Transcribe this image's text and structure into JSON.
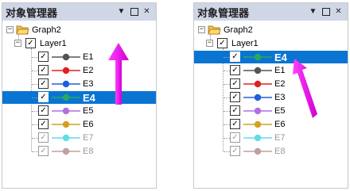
{
  "panels": [
    {
      "title": "对象管理器",
      "graph": "Graph2",
      "layer": "Layer1",
      "items": [
        {
          "label": "E1",
          "color": "#555555",
          "dim": false,
          "selected": false
        },
        {
          "label": "E2",
          "color": "#e02020",
          "dim": false,
          "selected": false
        },
        {
          "label": "E3",
          "color": "#1e60d8",
          "dim": false,
          "selected": false
        },
        {
          "label": "E4",
          "color": "#2aa860",
          "dim": false,
          "selected": true
        },
        {
          "label": "E5",
          "color": "#b070e0",
          "dim": false,
          "selected": false
        },
        {
          "label": "E6",
          "color": "#d4a020",
          "dim": false,
          "selected": false
        },
        {
          "label": "E7",
          "color": "#60dcea",
          "dim": true,
          "selected": false
        },
        {
          "label": "E8",
          "color": "#c0a0a0",
          "dim": true,
          "selected": false
        }
      ]
    },
    {
      "title": "对象管理器",
      "graph": "Graph2",
      "layer": "Layer1",
      "items": [
        {
          "label": "E4",
          "color": "#2aa860",
          "dim": false,
          "selected": true
        },
        {
          "label": "E1",
          "color": "#555555",
          "dim": false,
          "selected": false
        },
        {
          "label": "E2",
          "color": "#e02020",
          "dim": false,
          "selected": false
        },
        {
          "label": "E3",
          "color": "#1e60d8",
          "dim": false,
          "selected": false
        },
        {
          "label": "E5",
          "color": "#b070e0",
          "dim": false,
          "selected": false
        },
        {
          "label": "E6",
          "color": "#d4a020",
          "dim": false,
          "selected": false
        },
        {
          "label": "E7",
          "color": "#60dcea",
          "dim": true,
          "selected": false
        },
        {
          "label": "E8",
          "color": "#c0a0a0",
          "dim": true,
          "selected": false
        }
      ]
    }
  ],
  "titlebar_buttons": {
    "dropdown_glyph": "▼",
    "close_glyph": "✕"
  },
  "icons": {
    "folder": "folder-icon",
    "check": "✓",
    "expander_open": "−"
  },
  "accent": {
    "selection": "#0a74d2",
    "arrow": "#ee10ee",
    "titlebar": "#cfd6e5"
  }
}
